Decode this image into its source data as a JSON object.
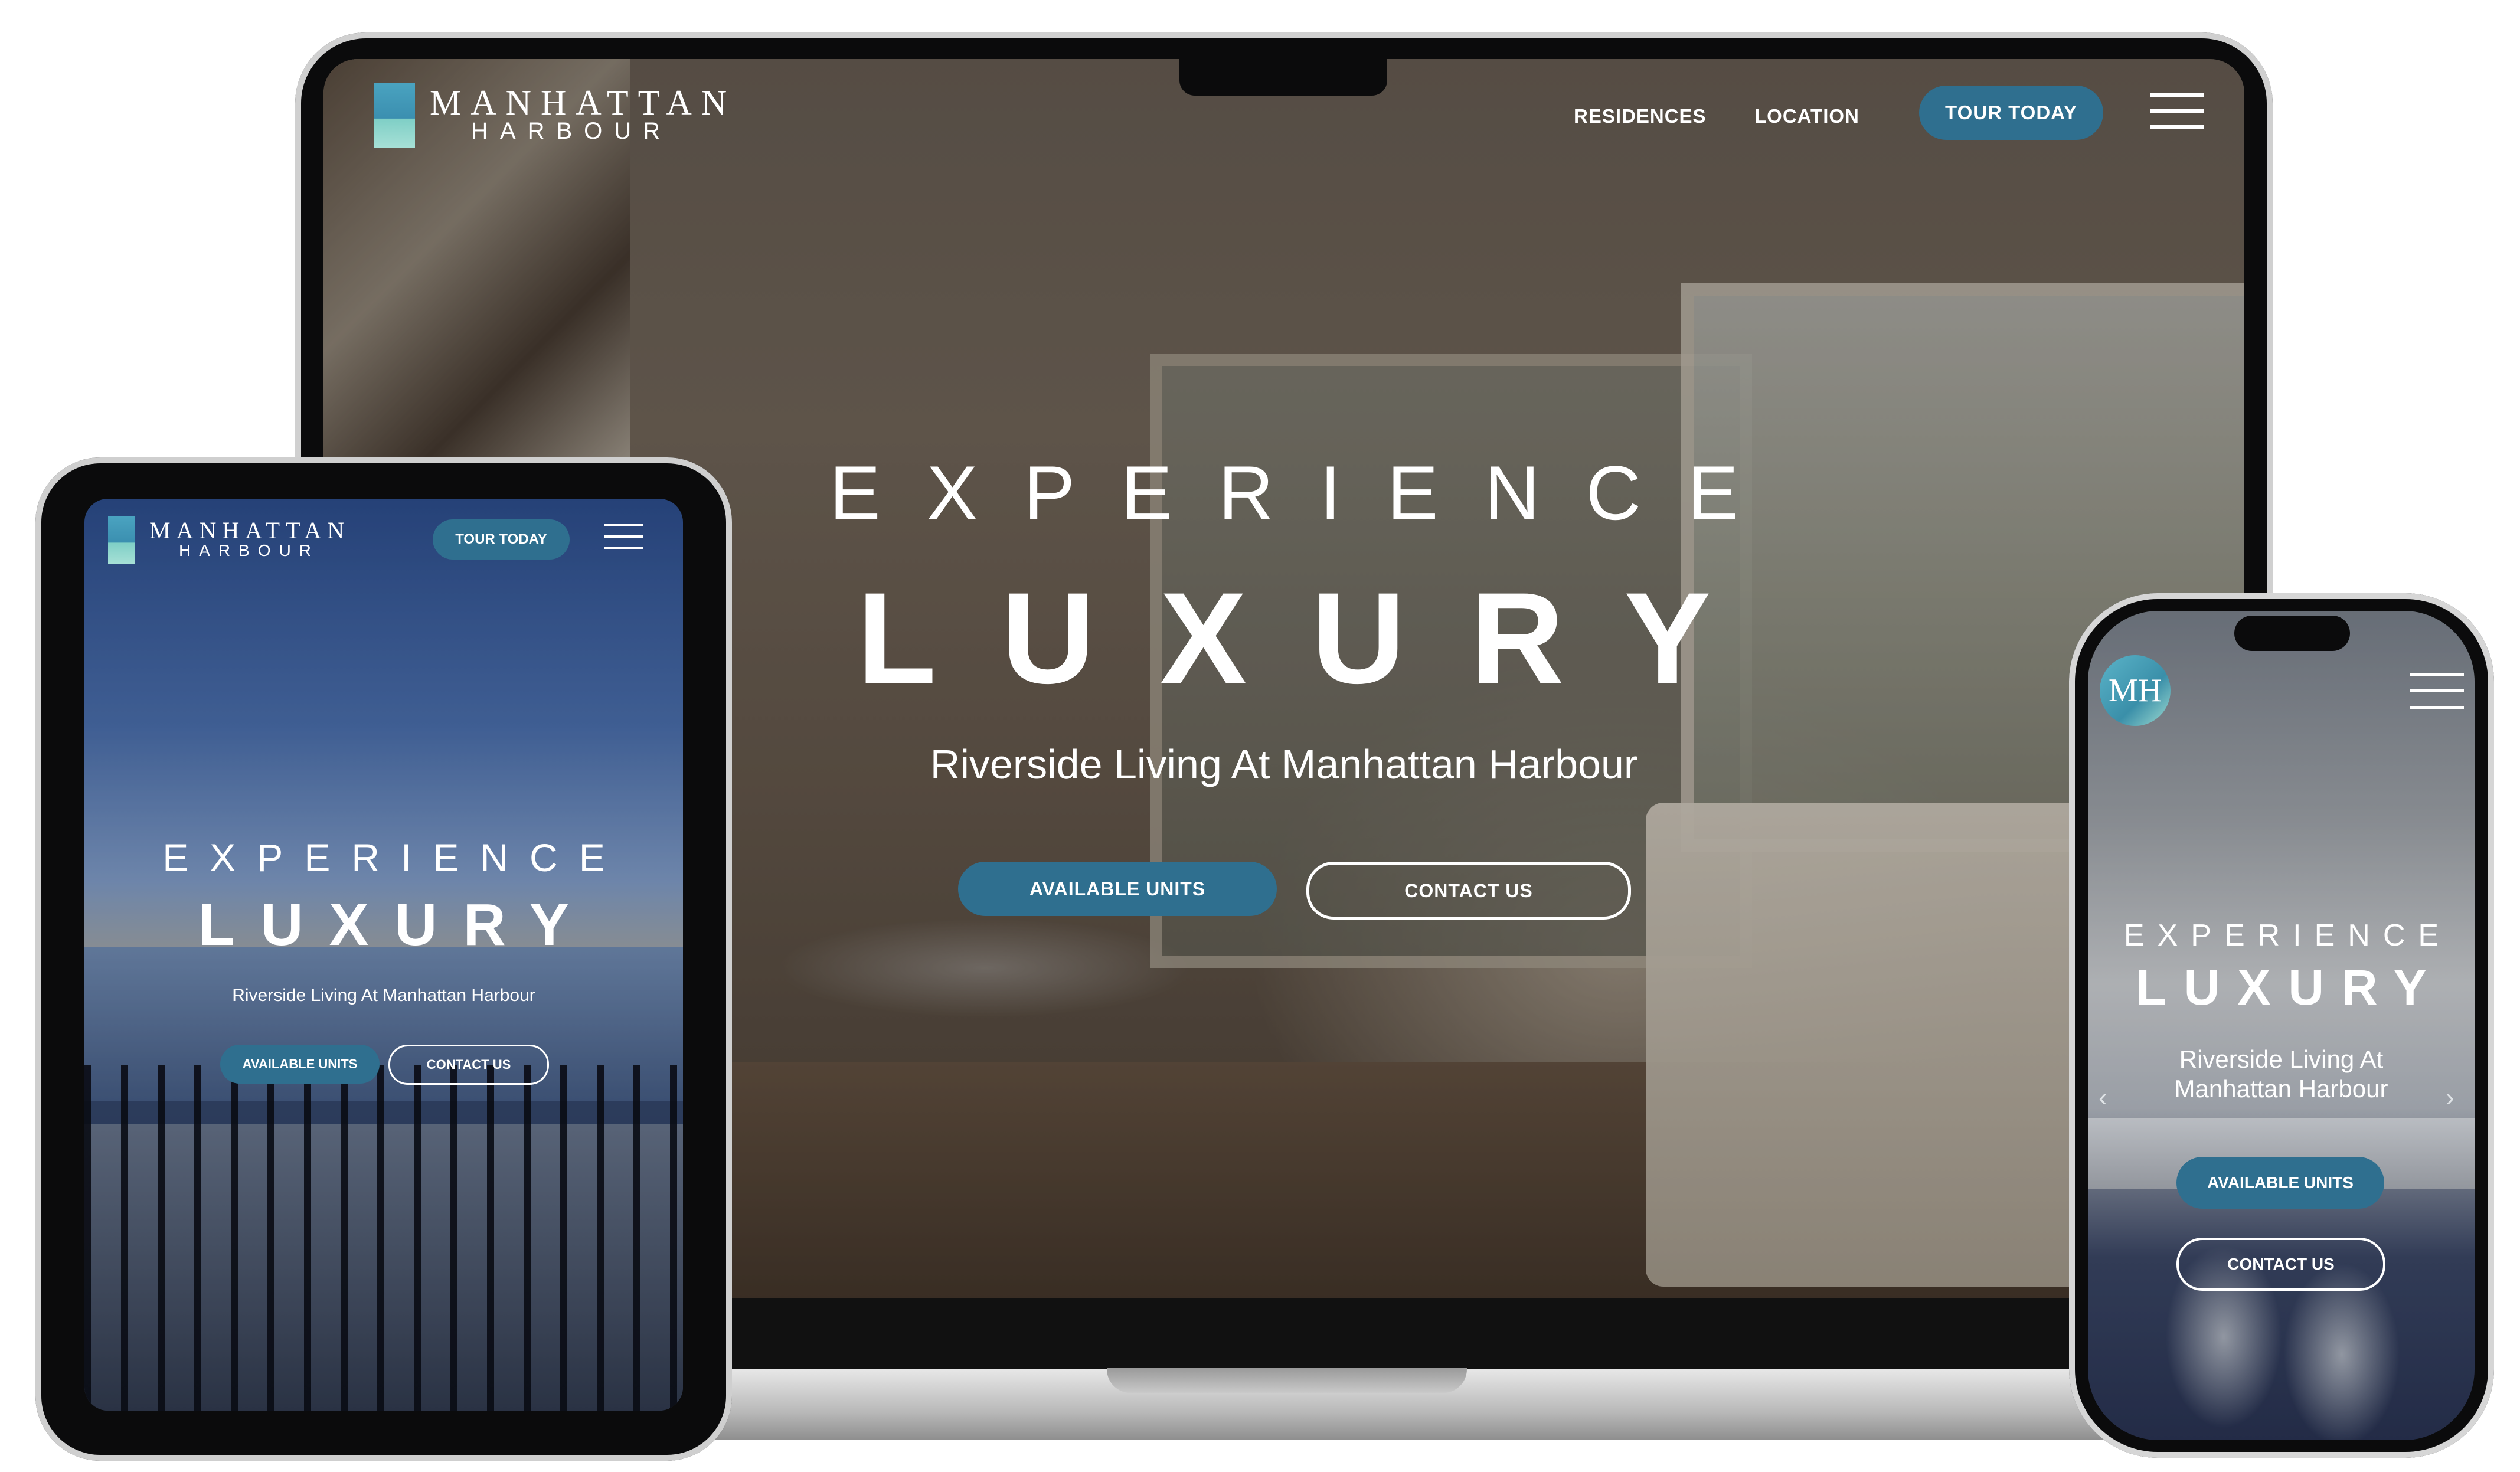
{
  "brand": {
    "line1": "MANHATTAN",
    "line2": "HARBOUR",
    "monogram": "MH"
  },
  "desktop": {
    "nav": {
      "residences": "RESIDENCES",
      "location": "LOCATION",
      "tour": "TOUR TODAY"
    },
    "hero": {
      "line1": "EXPERIENCE",
      "line2": "LUXURY",
      "subtitle": "Riverside Living At Manhattan Harbour"
    },
    "buttons": {
      "units": "AVAILABLE UNITS",
      "contact": "CONTACT US"
    }
  },
  "tablet": {
    "nav": {
      "tour": "TOUR TODAY"
    },
    "hero": {
      "line1": "EXPERIENCE",
      "line2": "LUXURY",
      "subtitle": "Riverside Living At Manhattan Harbour"
    },
    "buttons": {
      "units": "AVAILABLE UNITS",
      "contact": "CONTACT US"
    }
  },
  "mobile": {
    "hero": {
      "line1": "EXPERIENCE",
      "line2": "LUXURY",
      "subtitle": "Riverside Living At Manhattan Harbour"
    },
    "carousel": {
      "prev": "‹",
      "next": "›"
    },
    "buttons": {
      "units": "AVAILABLE UNITS",
      "contact": "CONTACT US"
    }
  },
  "colors": {
    "accent": "#2f6f8f",
    "logo_blue": "#3b8fb0",
    "logo_teal": "#a6e0d6"
  },
  "icons": [
    "menu-icon",
    "chevron-left-icon",
    "chevron-right-icon"
  ]
}
